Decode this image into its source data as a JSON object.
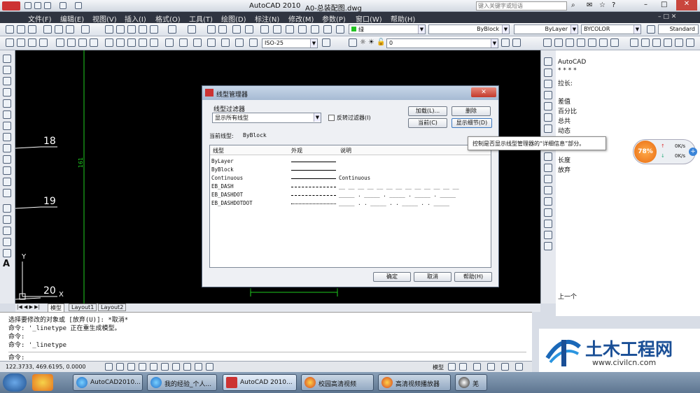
{
  "window": {
    "app": "AutoCAD 2010",
    "file": "A0-总装配图.dwg",
    "search_placeholder": "键入关键字或短语"
  },
  "menu": [
    "文件(F)",
    "编辑(E)",
    "视图(V)",
    "插入(I)",
    "格式(O)",
    "工具(T)",
    "绘图(D)",
    "标注(N)",
    "修改(M)",
    "参数(P)",
    "窗口(W)",
    "帮助(H)"
  ],
  "toolbar": {
    "layer": "绿",
    "layer_num": "0",
    "linetype": "ByBlock",
    "lineweight": "ByLayer",
    "color": "BYCOLOR",
    "textstyle": "Standard",
    "dimstyle": "ISO-25"
  },
  "drawing": {
    "labels": [
      "18",
      "19",
      "20"
    ],
    "vert": "161",
    "axis_y": "Y",
    "axis_x": "X"
  },
  "tabs": [
    "模型",
    "Layout1",
    "Layout2"
  ],
  "dialog": {
    "title": "线型管理器",
    "filter_label": "线型过滤器",
    "filter_value": "显示所有线型",
    "invert": "反转过滤器(I)",
    "load": "加载(L)...",
    "delete": "删除",
    "current": "当前(C)",
    "details": "显示细节(D)",
    "current_label": "当前线型:",
    "current_value": "ByBlock",
    "columns": [
      "线型",
      "外观",
      "说明"
    ],
    "rows": [
      {
        "name": "ByLayer",
        "desc": ""
      },
      {
        "name": "ByBlock",
        "desc": ""
      },
      {
        "name": "Continuous",
        "desc": "Continuous"
      },
      {
        "name": "EB_DASH",
        "desc": "__ __ __ __ __ __ __ __ __ __ __ __ __"
      },
      {
        "name": "EB_DASHDOT",
        "desc": "_____ . _____ . _____ . _____ . _____"
      },
      {
        "name": "EB_DASHDOTDOT",
        "desc": "_____ . . _____ . . _____ . . _____"
      }
    ],
    "ok": "确定",
    "cancel": "取消",
    "help": "帮助(H)"
  },
  "tooltip": "控制是否显示线型管理器的“详细信息”部分。",
  "right_panel": [
    "AutoCAD",
    "* * * *",
    "拉长:",
    "差值",
    "百分比",
    "总共",
    "动态",
    "长度",
    "放弃",
    "上一个"
  ],
  "cmd_lines": [
    "选择要修改的对象或 [放弃(U)]: *取消*",
    "命令: '_linetype 正在重生成模型。",
    "命令:",
    "命令: '_linetype",
    "命令:"
  ],
  "status": {
    "coords": "122.3733, 469.6195, 0.0000",
    "model": "模型"
  },
  "widget": {
    "percent": "78%",
    "up": "0K/s",
    "down": "0K/s"
  },
  "taskbar": [
    "AutoCAD2010...",
    "我的经验_个人...",
    "AutoCAD 2010...",
    "校园高清视频",
    "高清视频播放器",
    "羌"
  ],
  "logo": {
    "cn": "土木工程网",
    "url": "www.civilcn.com"
  }
}
